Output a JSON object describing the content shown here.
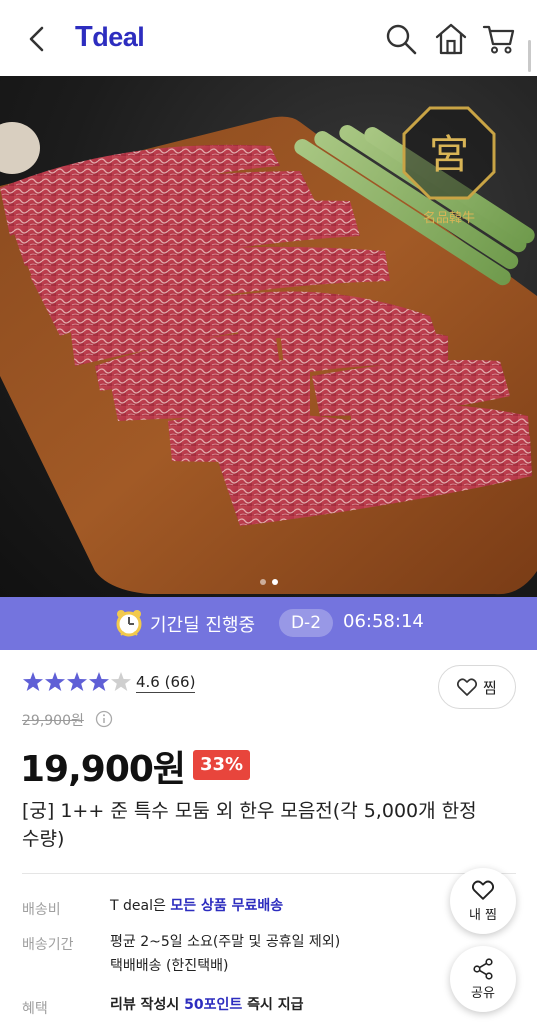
{
  "header": {
    "logo_t": "T",
    "logo_text": "deal",
    "icons": [
      "back-icon",
      "search-icon",
      "home-icon",
      "cart-icon"
    ]
  },
  "hero": {
    "seal_char": "宮",
    "seal_sub": "名品韓牛",
    "slide_count": 2,
    "active_slide": 2
  },
  "deal_banner": {
    "icon": "alarm-clock-icon",
    "text": "기간딜 진행중",
    "dday": "D-2",
    "timer": "06:58:14",
    "bg_color": "#7474de"
  },
  "rating": {
    "stars": 4.6,
    "value": "4.6",
    "count": "(66)"
  },
  "wish": {
    "label": "찜"
  },
  "price": {
    "original": "29,900원",
    "current": "19,900원",
    "discount": "33%",
    "discount_color": "#e8453c"
  },
  "product": {
    "title": "[궁] 1++ 준 특수 모둠 외 한우 모음전(각 5,000개 한정 수량)"
  },
  "shipping": {
    "fee_label": "배송비",
    "fee_prefix": "T deal은 ",
    "fee_highlight": "모든 상품 무료배송",
    "period_label": "배송기간",
    "period_line1": "평균 2~5일 소요(주말 및 공휴일 제외)",
    "period_line2": "택배배송 (한진택배)",
    "benefit_label": "혜택",
    "benefit_prefix": "리뷰 작성시 ",
    "benefit_points": "50포인트",
    "benefit_suffix": " 즉시 지급"
  },
  "fab": {
    "wish_label": "내 찜",
    "share_label": "공유"
  }
}
